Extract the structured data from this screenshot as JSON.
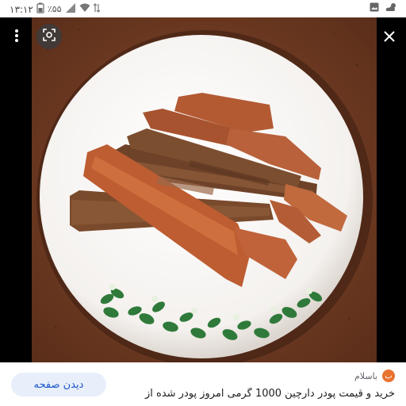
{
  "status_bar": {
    "time": "۱۳:۱۲",
    "battery": "٪۵۵",
    "icons_left": [
      "battery-icon",
      "no-sim-icon",
      "wifi-icon",
      "data-arrows-icon"
    ],
    "icons_right": [
      "gallery-icon",
      "weather-icon"
    ]
  },
  "viewer": {
    "image_subject": "cinnamon sticks on white plate",
    "accent_colors": {
      "background_brown": "#6b3a23",
      "plate": "#ffffff",
      "stick": "#b4562c"
    }
  },
  "toolbar": {
    "menu_icon": "more-vert-icon",
    "lens_icon": "google-lens-icon",
    "close_icon": "close-icon"
  },
  "card": {
    "source_name": "باسلام",
    "source_logo_text": "ب",
    "title": "خرید و قیمت پودر دارچین 1000 گرمی امروز پودر شده از",
    "visit_label": "دیدن صفحه",
    "visit_color": "#1a56c8"
  }
}
